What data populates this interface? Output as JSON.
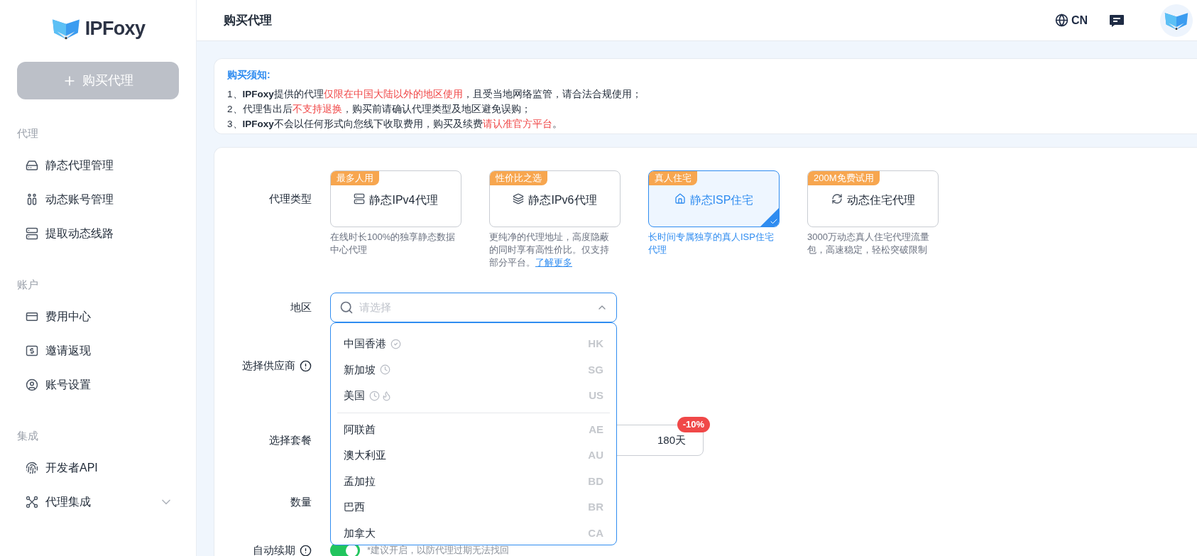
{
  "sidebar": {
    "logo_text": "IPFoxy",
    "buy_button": "购买代理",
    "sections": [
      {
        "title": "代理",
        "items": [
          {
            "label": "静态代理管理",
            "kind": "static",
            "expandable": false
          },
          {
            "label": "动态账号管理",
            "kind": "accounts",
            "expandable": false
          },
          {
            "label": "提取动态线路",
            "kind": "lines",
            "expandable": false
          }
        ]
      },
      {
        "title": "账户",
        "items": [
          {
            "label": "费用中心",
            "kind": "billing",
            "expandable": false
          },
          {
            "label": "邀请返现",
            "kind": "invite",
            "expandable": false
          },
          {
            "label": "账号设置",
            "kind": "user",
            "expandable": false
          }
        ]
      },
      {
        "title": "集成",
        "items": [
          {
            "label": "开发者API",
            "kind": "api",
            "expandable": false
          },
          {
            "label": "代理集成",
            "kind": "integration",
            "expandable": true
          }
        ]
      }
    ]
  },
  "header": {
    "title": "购买代理",
    "language": "CN"
  },
  "notice": {
    "title": "购买须知:",
    "lines": [
      [
        {
          "kind": "plain",
          "text": "1、"
        },
        {
          "kind": "strong",
          "text": "IPFoxy"
        },
        {
          "kind": "plain",
          "text": "提供的代理"
        },
        {
          "kind": "warn",
          "text": "仅限在中国大陆以外的地区使用"
        },
        {
          "kind": "plain",
          "text": "，且受当地网络监管，请合法合规使用；"
        }
      ],
      [
        {
          "kind": "plain",
          "text": "2、代理售出后"
        },
        {
          "kind": "warn",
          "text": "不支持退换"
        },
        {
          "kind": "plain",
          "text": "，购买前请确认代理类型及地区避免误购；"
        }
      ],
      [
        {
          "kind": "plain",
          "text": "3、"
        },
        {
          "kind": "strong",
          "text": "IPFoxy"
        },
        {
          "kind": "plain",
          "text": "不会以任何形式向您线下收取费用，购买及续费"
        },
        {
          "kind": "warn",
          "text": "请认准官方平台"
        },
        {
          "kind": "plain",
          "text": "。"
        }
      ]
    ]
  },
  "form": {
    "proxy_type": {
      "label": "代理类型",
      "options": [
        {
          "kind": "ipv4",
          "badge": "最多人用",
          "name": "静态IPv4代理",
          "description": "在线时长100%的独享静态数据中心代理",
          "selected": false
        },
        {
          "kind": "ipv6",
          "badge": "性价比之选",
          "name": "静态IPv6代理",
          "description": "更纯净的代理地址，高度隐蔽的同时享有高性价比。仅支持部分平台。",
          "link": "了解更多",
          "selected": false
        },
        {
          "kind": "isp",
          "badge": "真人住宅",
          "name": "静态ISP住宅",
          "description": "长时间专属独享的真人ISP住宅代理",
          "selected": true
        },
        {
          "kind": "dynamic",
          "badge": "200M免费试用",
          "name": "动态住宅代理",
          "description": "3000万动态真人住宅代理流量包，高速稳定，轻松突破限制",
          "selected": false
        }
      ]
    },
    "region": {
      "label": "地区",
      "placeholder": "请选择",
      "expanded": true,
      "groups": [
        [
          {
            "name": "中国香港",
            "code": "HK",
            "verified": true,
            "clock": false,
            "hot": false
          },
          {
            "name": "新加坡",
            "code": "SG",
            "verified": false,
            "clock": true,
            "hot": false
          },
          {
            "name": "美国",
            "code": "US",
            "verified": false,
            "clock": true,
            "hot": true
          }
        ],
        [
          {
            "name": "阿联酋",
            "code": "AE"
          },
          {
            "name": "澳大利亚",
            "code": "AU"
          },
          {
            "name": "孟加拉",
            "code": "BD"
          },
          {
            "name": "巴西",
            "code": "BR"
          },
          {
            "name": "加拿大",
            "code": "CA"
          }
        ]
      ]
    },
    "supplier": {
      "label": "选择供应商"
    },
    "package": {
      "label": "选择套餐",
      "option": "180天",
      "discount": "-10%"
    },
    "quantity": {
      "label": "数量"
    },
    "auto_renew": {
      "label": "自动续期",
      "on": true,
      "hint": "*建议开启，以防代理过期无法找回"
    }
  }
}
